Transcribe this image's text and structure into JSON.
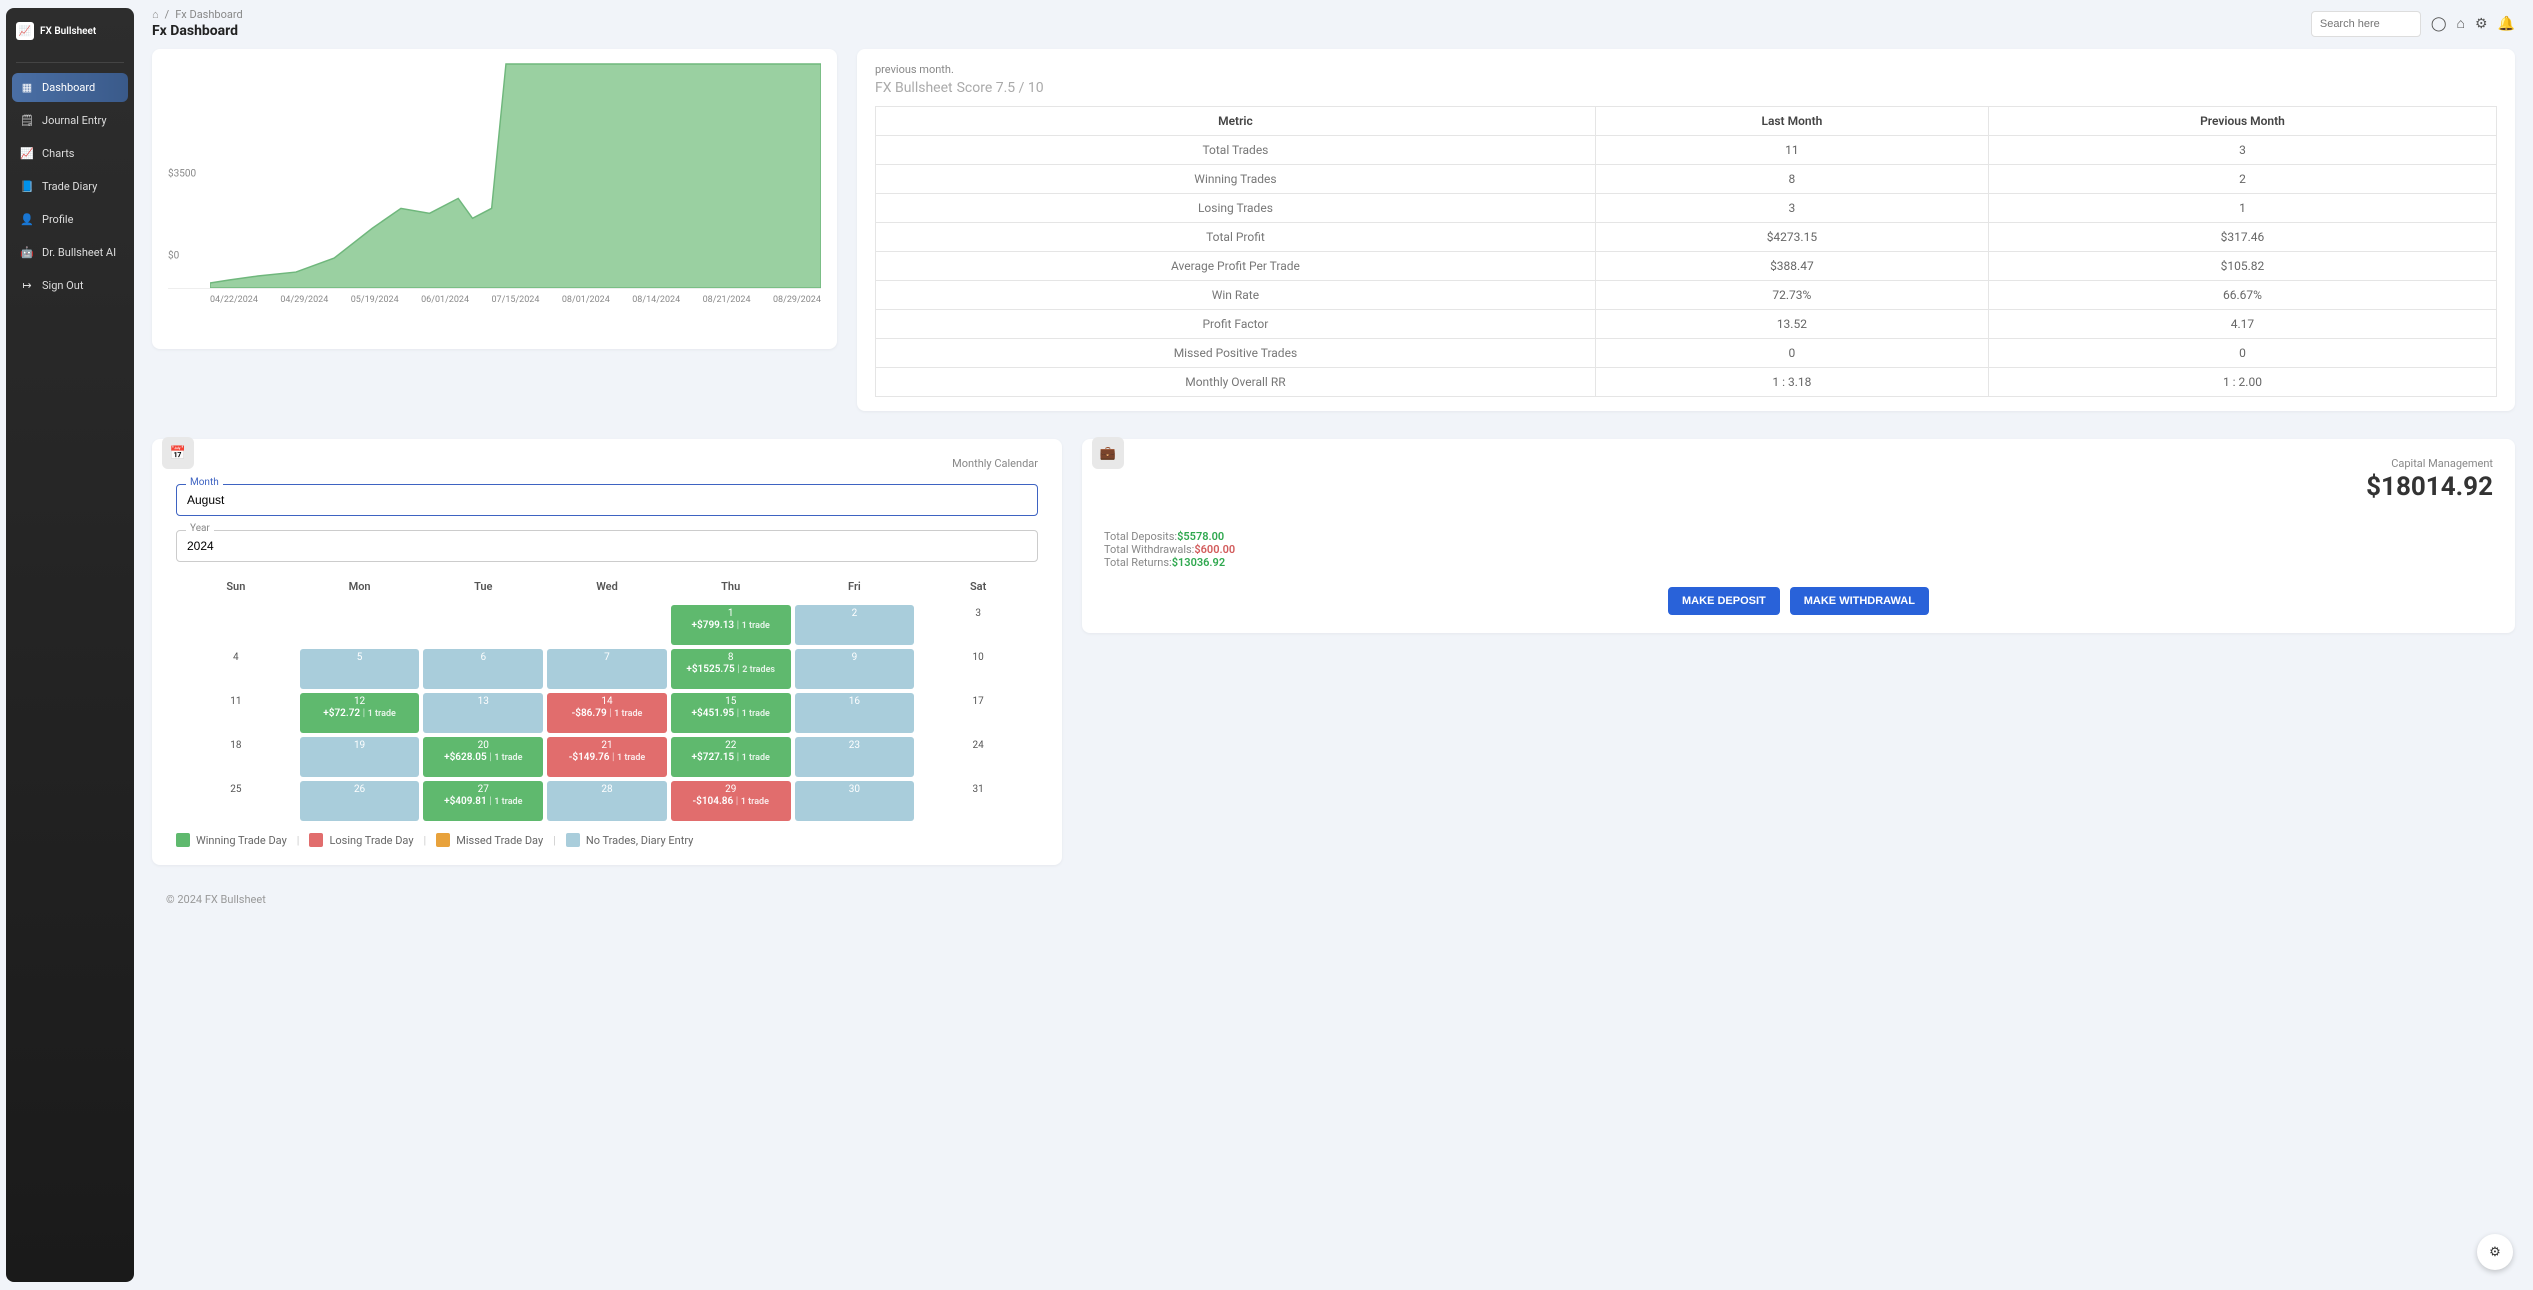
{
  "brand": "FX Bullsheet",
  "nav": [
    {
      "label": "Dashboard",
      "icon": "▦"
    },
    {
      "label": "Journal Entry",
      "icon": "🗒"
    },
    {
      "label": "Charts",
      "icon": "📈"
    },
    {
      "label": "Trade Diary",
      "icon": "📘"
    },
    {
      "label": "Profile",
      "icon": "👤"
    },
    {
      "label": "Dr. Bullsheet AI",
      "icon": "🤖"
    },
    {
      "label": "Sign Out",
      "icon": "↦"
    }
  ],
  "breadcrumb": {
    "home_icon": "⌂",
    "sep": "/",
    "current": "Fx Dashboard"
  },
  "page_title": "Fx Dashboard",
  "search_placeholder": "Search here",
  "chart_data": {
    "type": "area",
    "title": "",
    "ylabel": "",
    "yticks": [
      "$0",
      "$3500"
    ],
    "xticks": [
      "04/22/2024",
      "04/29/2024",
      "05/19/2024",
      "06/01/2024",
      "07/15/2024",
      "08/01/2024",
      "08/14/2024",
      "08/21/2024",
      "08/29/2024"
    ],
    "series": [
      {
        "name": "balance",
        "values": [
          200,
          250,
          300,
          350,
          900,
          1200,
          1400,
          1100,
          1300,
          7000,
          7000,
          7000,
          7000,
          7000,
          7000,
          7000,
          7000
        ]
      }
    ],
    "ylim": [
      0,
      7000
    ]
  },
  "table": {
    "note": "previous month.",
    "title_prefix": "FX Bullsheet",
    "title_rest": " Score 7.5 / 10",
    "headers": [
      "Metric",
      "Last Month",
      "Previous Month"
    ],
    "rows": [
      [
        "Total Trades",
        "11",
        "3"
      ],
      [
        "Winning Trades",
        "8",
        "2"
      ],
      [
        "Losing Trades",
        "3",
        "1"
      ],
      [
        "Total Profit",
        "$4273.15",
        "$317.46"
      ],
      [
        "Average Profit Per Trade",
        "$388.47",
        "$105.82"
      ],
      [
        "Win Rate",
        "72.73%",
        "66.67%"
      ],
      [
        "Profit Factor",
        "13.52",
        "4.17"
      ],
      [
        "Missed Positive Trades",
        "0",
        "0"
      ],
      [
        "Monthly Overall RR",
        "1 : 3.18",
        "1 : 2.00"
      ]
    ]
  },
  "calendar": {
    "title": "Monthly Calendar",
    "month_label": "Month",
    "month_value": "August",
    "year_label": "Year",
    "year_value": "2024",
    "days": [
      "Sun",
      "Mon",
      "Tue",
      "Wed",
      "Thu",
      "Fri",
      "Sat"
    ],
    "cells": [
      {
        "type": "blank"
      },
      {
        "type": "blank"
      },
      {
        "type": "blank"
      },
      {
        "type": "blank"
      },
      {
        "type": "win",
        "day": "1",
        "pnl": "+$799.13",
        "sub": "1 trade"
      },
      {
        "type": "notrade",
        "day": "2"
      },
      {
        "type": "empty",
        "day": "3"
      },
      {
        "type": "empty",
        "day": "4"
      },
      {
        "type": "notrade",
        "day": "5"
      },
      {
        "type": "notrade",
        "day": "6"
      },
      {
        "type": "notrade",
        "day": "7"
      },
      {
        "type": "win",
        "day": "8",
        "pnl": "+$1525.75",
        "sub": "2 trades"
      },
      {
        "type": "notrade",
        "day": "9"
      },
      {
        "type": "empty",
        "day": "10"
      },
      {
        "type": "empty",
        "day": "11"
      },
      {
        "type": "win",
        "day": "12",
        "pnl": "+$72.72",
        "sub": "1 trade"
      },
      {
        "type": "notrade",
        "day": "13"
      },
      {
        "type": "lose",
        "day": "14",
        "pnl": "-$86.79",
        "sub": "1 trade"
      },
      {
        "type": "win",
        "day": "15",
        "pnl": "+$451.95",
        "sub": "1 trade"
      },
      {
        "type": "notrade",
        "day": "16"
      },
      {
        "type": "empty",
        "day": "17"
      },
      {
        "type": "empty",
        "day": "18"
      },
      {
        "type": "notrade",
        "day": "19"
      },
      {
        "type": "win",
        "day": "20",
        "pnl": "+$628.05",
        "sub": "1 trade"
      },
      {
        "type": "lose",
        "day": "21",
        "pnl": "-$149.76",
        "sub": "1 trade"
      },
      {
        "type": "win",
        "day": "22",
        "pnl": "+$727.15",
        "sub": "1 trade"
      },
      {
        "type": "notrade",
        "day": "23"
      },
      {
        "type": "empty",
        "day": "24"
      },
      {
        "type": "empty",
        "day": "25"
      },
      {
        "type": "notrade",
        "day": "26"
      },
      {
        "type": "win",
        "day": "27",
        "pnl": "+$409.81",
        "sub": "1 trade"
      },
      {
        "type": "notrade",
        "day": "28"
      },
      {
        "type": "lose",
        "day": "29",
        "pnl": "-$104.86",
        "sub": "1 trade"
      },
      {
        "type": "notrade",
        "day": "30"
      },
      {
        "type": "empty",
        "day": "31"
      }
    ],
    "legend": [
      {
        "color": "#5fb96e",
        "label": "Winning Trade Day"
      },
      {
        "color": "#e16d6d",
        "label": "Losing Trade Day"
      },
      {
        "color": "#e8a23c",
        "label": "Missed Trade Day"
      },
      {
        "color": "#a9cddb",
        "label": "No Trades, Diary Entry"
      }
    ]
  },
  "capital": {
    "title": "Capital Management",
    "balance": "$18014.92",
    "rows": [
      {
        "label": "Total Deposits:",
        "value": "$5578.00",
        "cls": "g"
      },
      {
        "label": "Total Withdrawals:",
        "value": "$600.00",
        "cls": "r"
      },
      {
        "label": "Total Returns:",
        "value": "$13036.92",
        "cls": "g"
      }
    ],
    "deposit_btn": "MAKE DEPOSIT",
    "withdraw_btn": "MAKE WITHDRAWAL"
  },
  "footer": "© 2024 FX Bullsheet"
}
